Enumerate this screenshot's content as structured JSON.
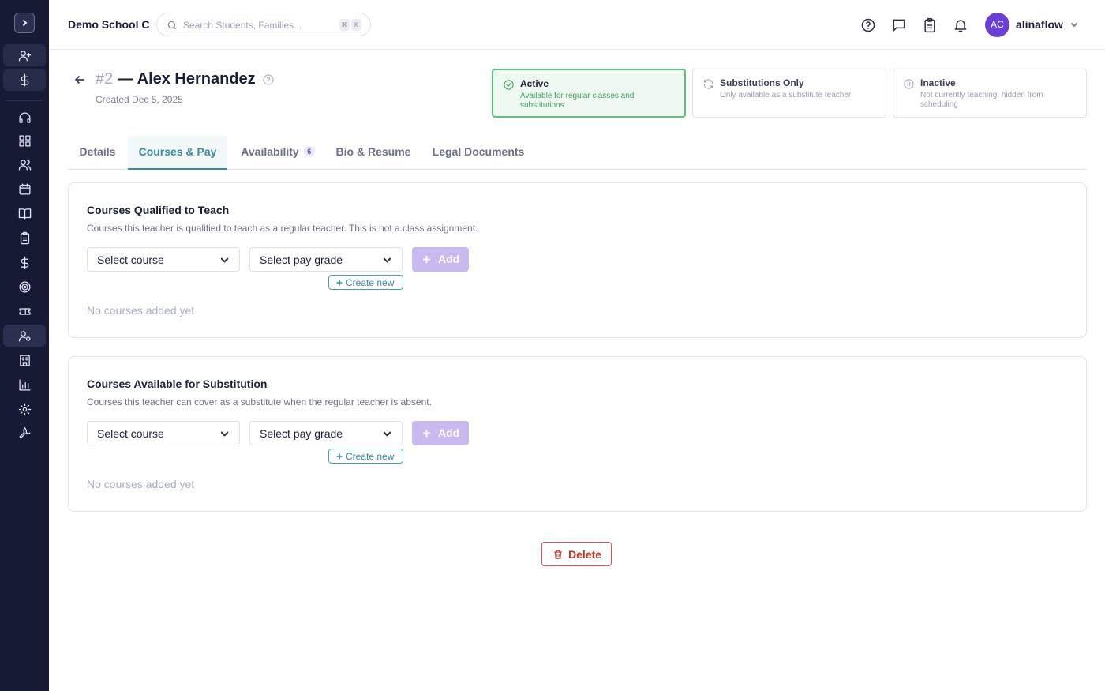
{
  "sidebar": {
    "toggle_icon": "chevron-right-icon",
    "items": [
      {
        "name": "add-user-icon",
        "active": false
      },
      {
        "name": "dollar-icon",
        "active": false
      },
      {
        "name": "headset-icon",
        "active": false
      },
      {
        "name": "dashboard-icon",
        "active": false
      },
      {
        "name": "users-icon",
        "active": false
      },
      {
        "name": "calendar-icon",
        "active": false
      },
      {
        "name": "book-icon",
        "active": false
      },
      {
        "name": "clipboard-icon",
        "active": false
      },
      {
        "name": "dollar-icon",
        "active": false
      },
      {
        "name": "target-icon",
        "active": false
      },
      {
        "name": "ticket-icon",
        "active": false
      },
      {
        "name": "user-settings-icon",
        "active": true
      },
      {
        "name": "building-icon",
        "active": false
      },
      {
        "name": "bar-chart-icon",
        "active": false
      },
      {
        "name": "gear-icon",
        "active": false
      },
      {
        "name": "wrench-icon",
        "active": false
      }
    ]
  },
  "header": {
    "school_name": "Demo School C",
    "search_placeholder": "Search Students, Families...",
    "shortcut_keys": [
      "⌘",
      "K"
    ],
    "user_initials": "AC",
    "username": "alinaflow"
  },
  "profile": {
    "number": "#2",
    "name": "— Alex Hernandez",
    "created": "Created Dec 5, 2025"
  },
  "statuses": [
    {
      "title": "Active",
      "desc": "Available for regular classes and substitutions",
      "selected": true
    },
    {
      "title": "Substitutions Only",
      "desc": "Only available as a substitute teacher",
      "selected": false
    },
    {
      "title": "Inactive",
      "desc": "Not currently teaching, hidden from scheduling",
      "selected": false
    }
  ],
  "tabs": [
    {
      "label": "Details"
    },
    {
      "label": "Courses & Pay",
      "selected": true
    },
    {
      "label": "Availability",
      "badge": "6"
    },
    {
      "label": "Bio & Resume"
    },
    {
      "label": "Legal Documents"
    }
  ],
  "qualified": {
    "title": "Courses Qualified to Teach",
    "desc": "Courses this teacher is qualified to teach as a regular teacher. This is not a class assignment.",
    "course_select": "Select course",
    "pay_select": "Select pay grade",
    "add_label": "Add",
    "create_label": "Create new",
    "empty": "No courses added yet"
  },
  "substitution": {
    "title": "Courses Available for Substitution",
    "desc": "Courses this teacher can cover as a substitute when the regular teacher is absent.",
    "course_select": "Select course",
    "pay_select": "Select pay grade",
    "add_label": "Add",
    "create_label": "Create new",
    "empty": "No courses added yet"
  },
  "delete_label": "Delete",
  "colors": {
    "sidebar_bg": "#161a35",
    "accent_teal": "#3a8a9a",
    "active_green": "#5ec27c",
    "add_button": "#c9b9ee",
    "avatar": "#6b3fd4",
    "danger": "#c0392b"
  }
}
